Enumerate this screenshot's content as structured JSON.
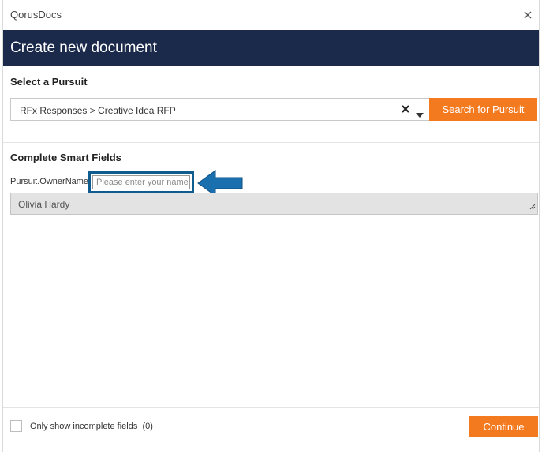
{
  "window": {
    "app_title": "QorusDocs"
  },
  "header": {
    "title": "Create new document"
  },
  "pursuit": {
    "section_title": "Select a Pursuit",
    "selected_value": "RFx Responses > Creative Idea RFP",
    "search_button_label": "Search for Pursuit"
  },
  "smart_fields": {
    "section_title": "Complete Smart Fields",
    "field_label": "Pursuit.OwnerName",
    "field_hint": "Please enter your name",
    "field_value": "Olivia Hardy"
  },
  "footer": {
    "checkbox_label": "Only show incomplete fields",
    "incomplete_count": "(0)",
    "continue_label": "Continue"
  },
  "colors": {
    "header_bg": "#1b2a4a",
    "accent_orange": "#f47a20",
    "highlight_blue": "#0f5c8f",
    "arrow_blue": "#1a6fae"
  },
  "icons": {
    "close": "close-icon",
    "clear": "clear-icon",
    "dropdown": "chevron-down-icon",
    "resize": "resize-handle-icon",
    "pointer": "arrow-left-icon"
  }
}
